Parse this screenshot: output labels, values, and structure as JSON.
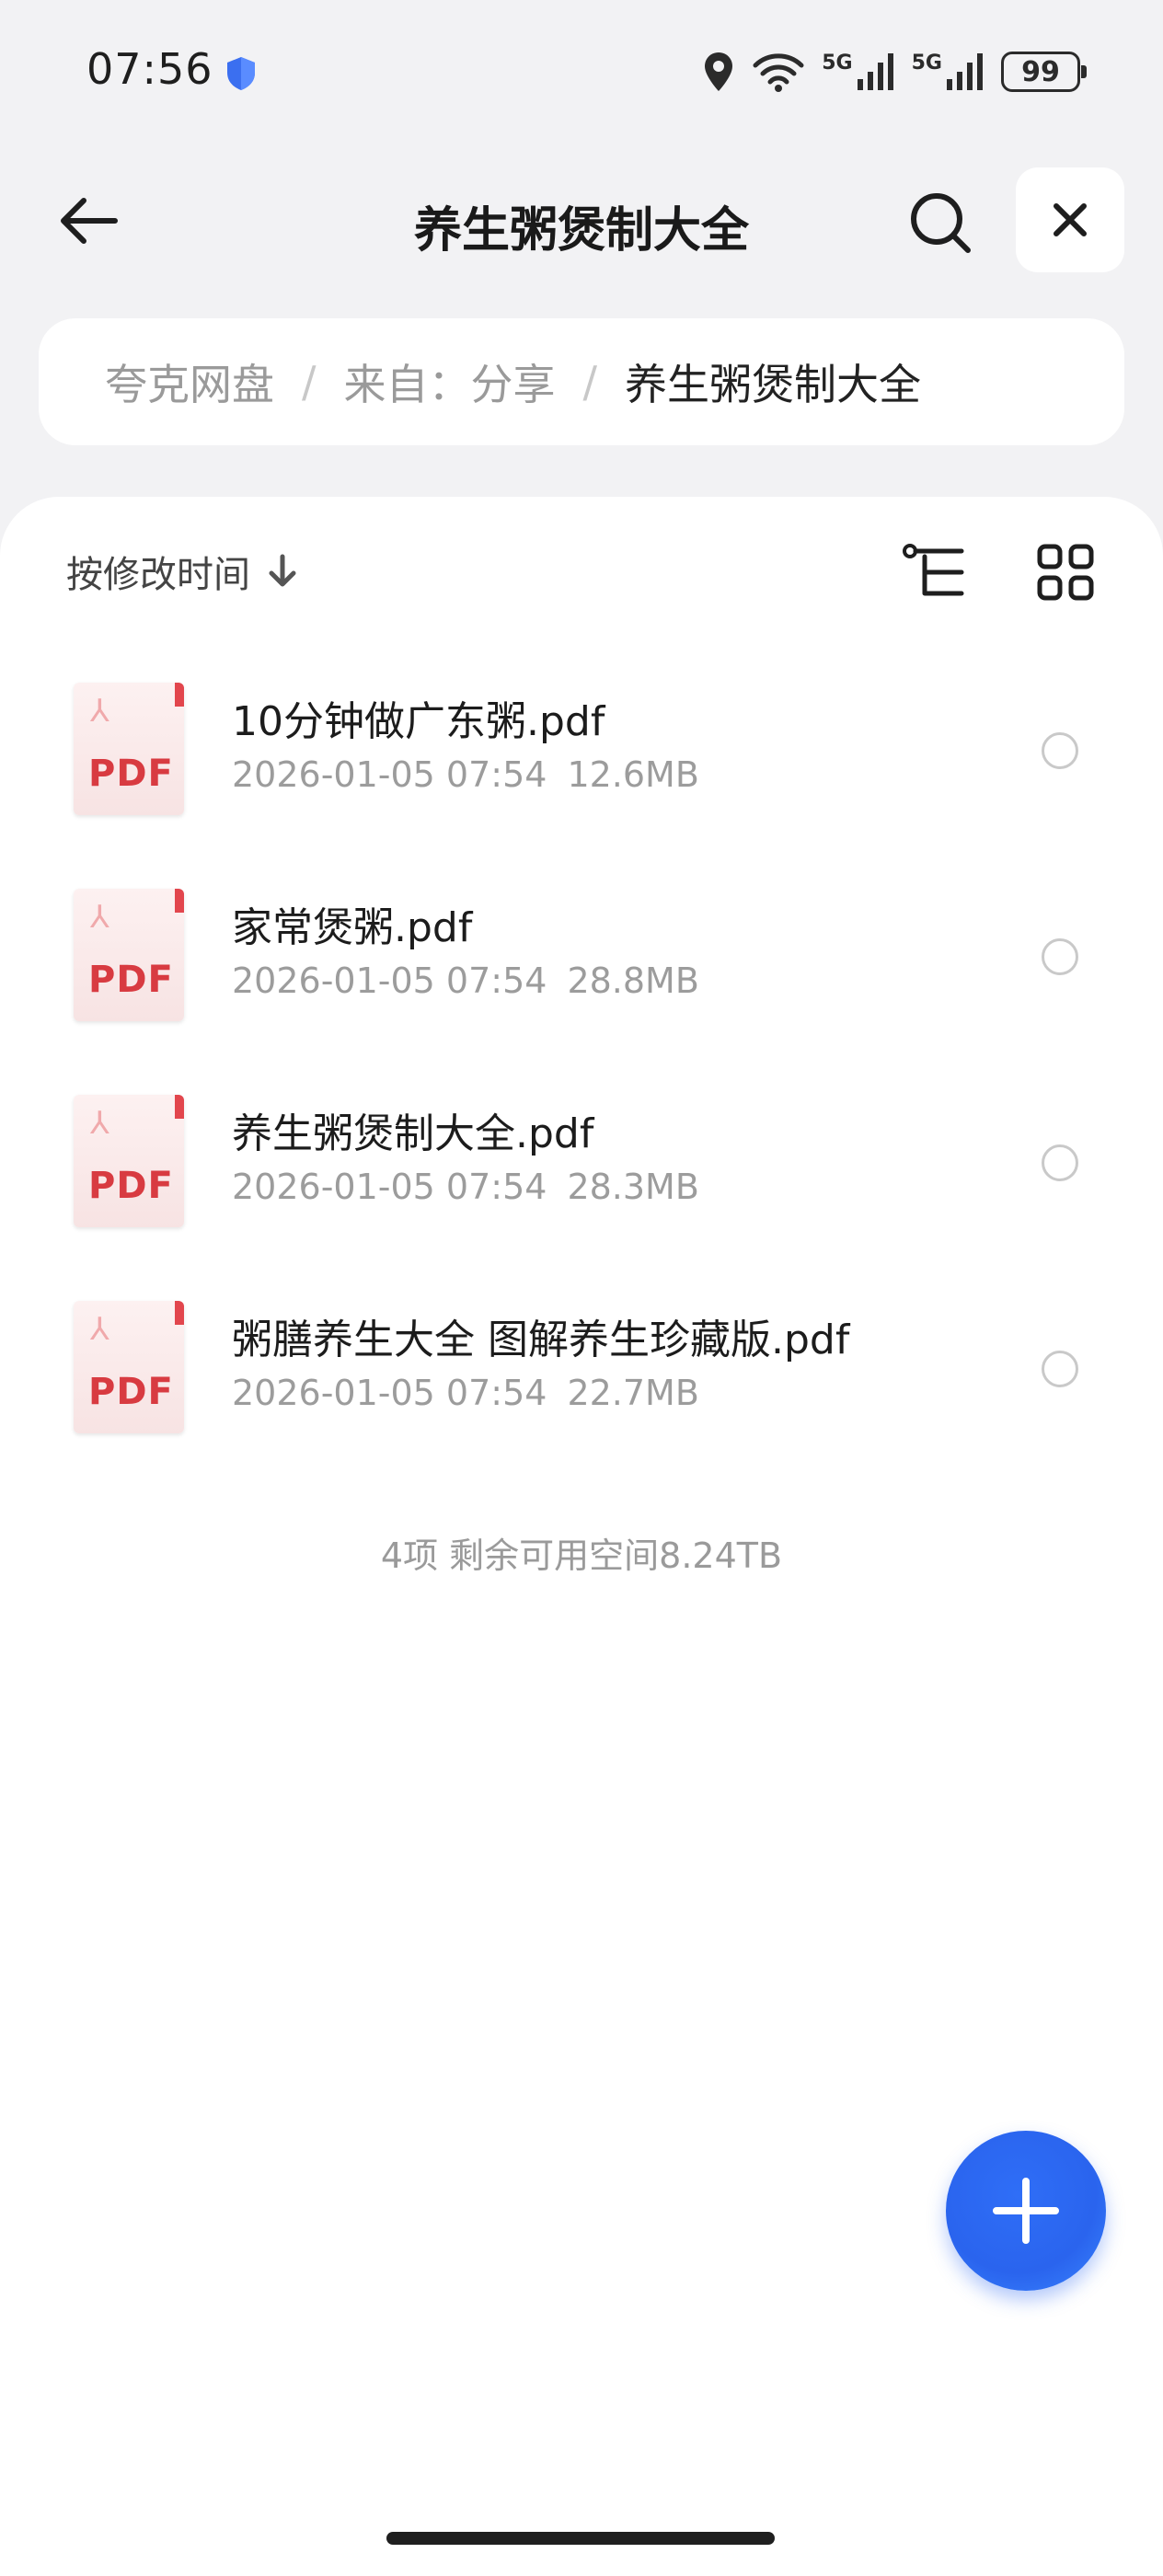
{
  "status_bar": {
    "time": "07:56",
    "network_1": "5G",
    "network_2": "5G",
    "battery": "99",
    "icons": [
      "shield-icon",
      "location-icon",
      "wifi-icon",
      "signal-icon",
      "signal-icon",
      "battery-icon"
    ]
  },
  "header": {
    "title": "养生粥煲制大全",
    "icons": [
      "back-arrow-icon",
      "search-icon",
      "close-icon"
    ]
  },
  "breadcrumb": {
    "items": [
      "夸克网盘",
      "来自：分享",
      "养生粥煲制大全"
    ],
    "separator": "/"
  },
  "toolbar": {
    "sort_label": "按修改时间",
    "icons": [
      "sort-arrow-down-icon",
      "tree-view-icon",
      "grid-view-icon"
    ]
  },
  "files": [
    {
      "icon_label": "PDF",
      "name": "10分钟做广东粥.pdf",
      "datetime": "2026-01-05 07:54",
      "size": "12.6MB"
    },
    {
      "icon_label": "PDF",
      "name": "家常煲粥.pdf",
      "datetime": "2026-01-05 07:54",
      "size": "28.8MB"
    },
    {
      "icon_label": "PDF",
      "name": "养生粥煲制大全.pdf",
      "datetime": "2026-01-05 07:54",
      "size": "28.3MB"
    },
    {
      "icon_label": "PDF",
      "name": "粥膳养生大全  图解养生珍藏版.pdf",
      "datetime": "2026-01-05 07:54",
      "size": "22.7MB"
    }
  ],
  "summary": "4项 剩余可用空间8.24TB",
  "colors": {
    "background": "#f2f2f4",
    "accent": "#2f6ef7",
    "pdf_red": "#d83b41"
  }
}
